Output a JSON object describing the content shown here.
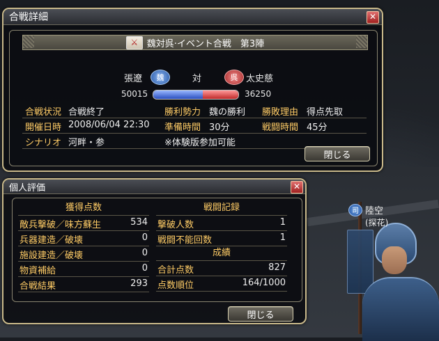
{
  "battle_detail": {
    "title": "合戦詳細",
    "close_icon": "close-icon",
    "banner_title": "魏対呉·イベント合戦　第3陣",
    "left_general": "張遼",
    "left_faction": "魏",
    "versus": "対",
    "right_faction": "呉",
    "right_general": "太史慈",
    "left_score": "50015",
    "right_score": "36250",
    "power_ratio": 0.58,
    "rows": [
      {
        "l1": "合戦状況",
        "v1": "合戦終了",
        "l2": "勝利勢力",
        "v2": "魏の勝利",
        "l3": "勝敗理由",
        "v3": "得点先取"
      },
      {
        "l1": "開催日時",
        "v1": "2008/06/04 22:30",
        "l2": "準備時間",
        "v2": "30分",
        "l3": "戦闘時間",
        "v3": "45分"
      },
      {
        "l1": "シナリオ",
        "v1": "河畔・参",
        "l2": "※体験版参加可能",
        "v2": "",
        "l3": "",
        "v3": ""
      }
    ],
    "close_button": "閉じる"
  },
  "personal_eval": {
    "title": "個人評価",
    "left_header": "獲得点数",
    "left_stats": [
      {
        "k": "敵兵撃破／味方蘇生",
        "v": "534"
      },
      {
        "k": "兵器建造／破壊",
        "v": "0"
      },
      {
        "k": "施設建造／破壊",
        "v": "0"
      },
      {
        "k": "物資補給",
        "v": "0"
      },
      {
        "k": "合戦結果",
        "v": "293"
      }
    ],
    "right_header": "戦闘記録",
    "right_stats": [
      {
        "k": "撃破人数",
        "v": "1"
      },
      {
        "k": "戦闘不能回数",
        "v": "1"
      }
    ],
    "right_header2": "成績",
    "right_stats2": [
      {
        "k": "合計点数",
        "v": "827"
      },
      {
        "k": "点数順位",
        "v": "164/1000"
      }
    ],
    "close_button": "閉じる"
  },
  "character": {
    "emblem": "司",
    "name": "陸空",
    "subtitle": "(探花)"
  },
  "colors": {
    "label": "#ffcc66",
    "frame": "#c9b98a",
    "wei": "#2a4fc0",
    "wu": "#c02a2a"
  }
}
